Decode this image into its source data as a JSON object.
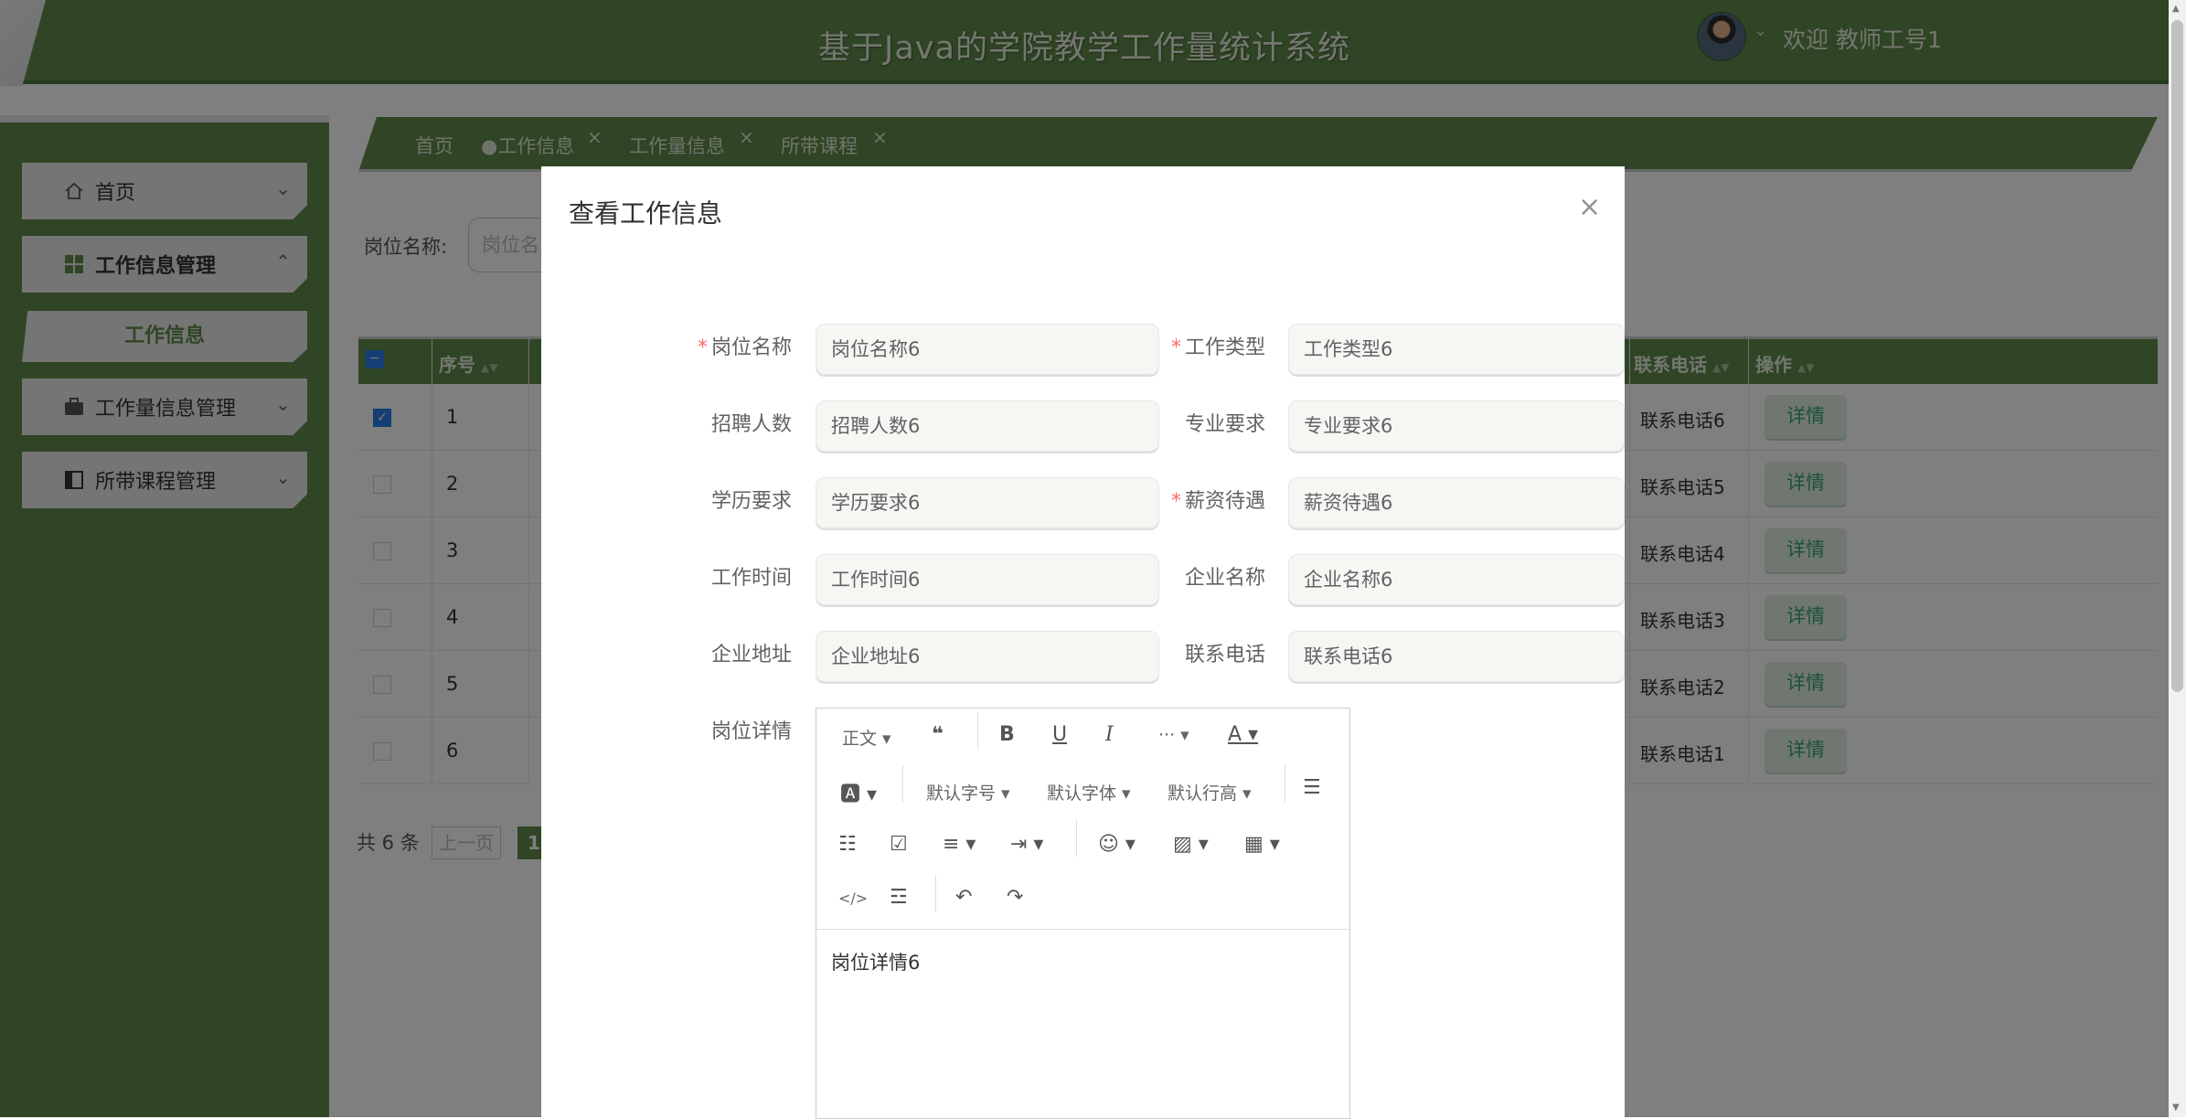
{
  "app": {
    "title": "基于Java的学院教学工作量统计系统",
    "welcome": "欢迎 教师工号1"
  },
  "sidebar": {
    "items": [
      {
        "label": "首页",
        "icon": "home-icon"
      },
      {
        "label": "工作信息管理",
        "icon": "grid-icon"
      },
      {
        "label": "工作信息",
        "icon": ""
      },
      {
        "label": "工作量信息管理",
        "icon": "briefcase-icon"
      },
      {
        "label": "所带课程管理",
        "icon": "panel-icon"
      }
    ]
  },
  "tabs": [
    {
      "label": "首页"
    },
    {
      "label": "●工作信息",
      "closable": true
    },
    {
      "label": "工作量信息",
      "closable": true
    },
    {
      "label": "所带课程",
      "closable": true
    }
  ],
  "search": {
    "label": "岗位名称:",
    "placeholder": "岗位名"
  },
  "table": {
    "headers": {
      "index": "序号",
      "phone": "联系电话",
      "ops": "操作"
    },
    "rows": [
      {
        "num": "1",
        "phone": "联系电话6",
        "action": "详情",
        "checked": true
      },
      {
        "num": "2",
        "phone": "联系电话5",
        "action": "详情",
        "checked": false
      },
      {
        "num": "3",
        "phone": "联系电话4",
        "action": "详情",
        "checked": false
      },
      {
        "num": "4",
        "phone": "联系电话3",
        "action": "详情",
        "checked": false
      },
      {
        "num": "5",
        "phone": "联系电话2",
        "action": "详情",
        "checked": false
      },
      {
        "num": "6",
        "phone": "联系电话1",
        "action": "详情",
        "checked": false
      }
    ]
  },
  "pagination": {
    "total": "共 6 条",
    "prev": "上一页",
    "current": "1"
  },
  "modal": {
    "title": "查看工作信息",
    "close": "×",
    "fields": {
      "job_name": {
        "label": "岗位名称",
        "value": "岗位名称6",
        "required": true
      },
      "job_type": {
        "label": "工作类型",
        "value": "工作类型6",
        "required": true
      },
      "hiring_count": {
        "label": "招聘人数",
        "value": "招聘人数6",
        "required": false
      },
      "major_req": {
        "label": "专业要求",
        "value": "专业要求6",
        "required": false
      },
      "education_req": {
        "label": "学历要求",
        "value": "学历要求6",
        "required": false
      },
      "salary": {
        "label": "薪资待遇",
        "value": "薪资待遇6",
        "required": true
      },
      "work_time": {
        "label": "工作时间",
        "value": "工作时间6",
        "required": false
      },
      "company_name": {
        "label": "企业名称",
        "value": "企业名称6",
        "required": false
      },
      "company_address": {
        "label": "企业地址",
        "value": "企业地址6",
        "required": false
      },
      "contact_phone": {
        "label": "联系电话",
        "value": "联系电话6",
        "required": false
      }
    },
    "editor": {
      "label": "岗位详情",
      "content": "岗位详情6",
      "toolbar": {
        "paragraph": "正文",
        "font_size": "默认字号",
        "font_family": "默认字体",
        "line_height": "默认行高"
      }
    }
  },
  "colors": {
    "primary": "#5e8a4a",
    "overlay": "rgba(0,0,0,0.5)",
    "accent_text": "#3aa37a"
  }
}
